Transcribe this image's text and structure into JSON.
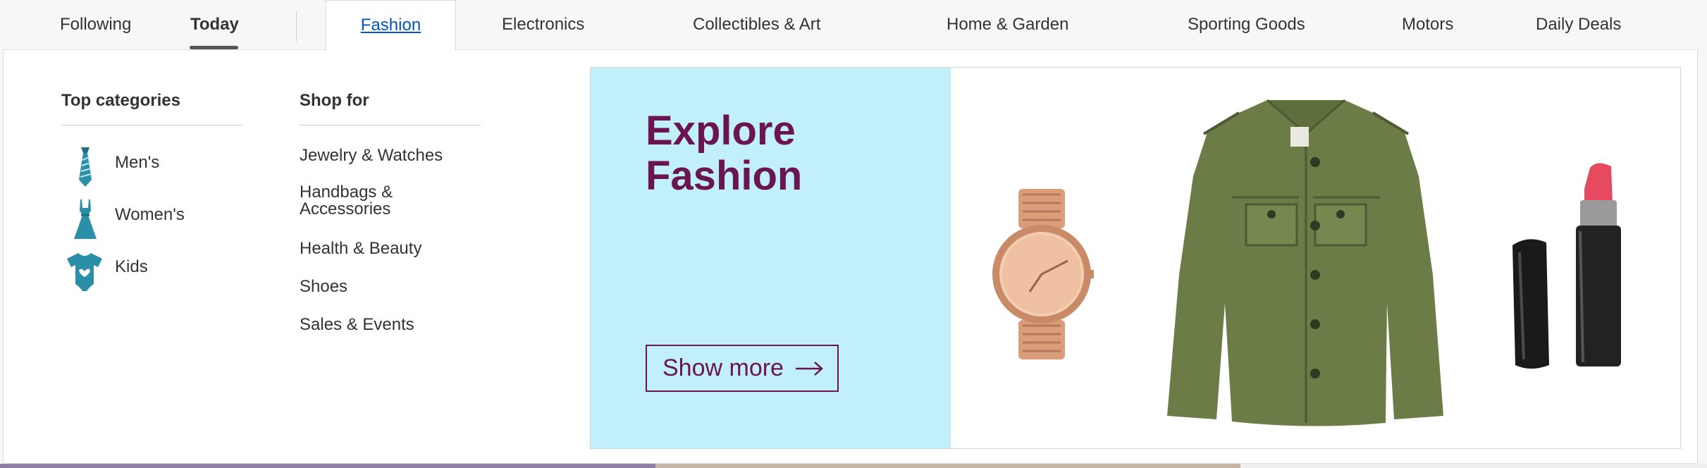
{
  "nav": {
    "following": "Following",
    "today": "Today",
    "fashion": "Fashion",
    "electronics": "Electronics",
    "collectibles": "Collectibles & Art",
    "home_garden": "Home & Garden",
    "sporting": "Sporting Goods",
    "motors": "Motors",
    "daily_deals": "Daily Deals"
  },
  "top_categories": {
    "heading": "Top categories",
    "items": [
      {
        "label": "Men's",
        "icon": "tie-icon"
      },
      {
        "label": "Women's",
        "icon": "dress-icon"
      },
      {
        "label": "Kids",
        "icon": "onesie-icon"
      }
    ]
  },
  "shop_for": {
    "heading": "Shop for",
    "items": [
      {
        "label": "Jewelry & Watches"
      },
      {
        "label": "Handbags & Accessories"
      },
      {
        "label": "Health & Beauty"
      },
      {
        "label": "Shoes"
      },
      {
        "label": "Sales & Events"
      }
    ]
  },
  "banner": {
    "title": "Explore Fashion",
    "cta": "Show more",
    "products": [
      "watch-image",
      "jacket-image",
      "lipstick-image"
    ]
  },
  "colors": {
    "link_blue": "#0654ba",
    "banner_bg": "#c2f0fa",
    "banner_text": "#6a1551",
    "icon_teal": "#2b8fa8"
  }
}
